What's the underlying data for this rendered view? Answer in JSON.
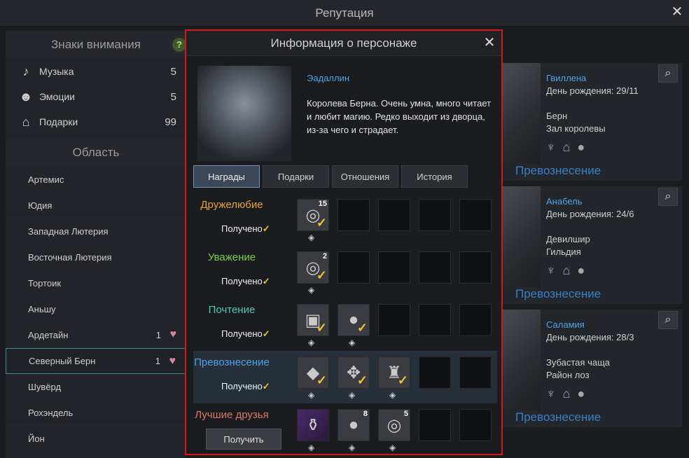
{
  "window": {
    "title": "Репутация"
  },
  "left": {
    "signs_header": "Знаки внимания",
    "help": "?",
    "signs": [
      {
        "label": "Музыка",
        "count": "5",
        "icon": "music-note-icon"
      },
      {
        "label": "Эмоции",
        "count": "5",
        "icon": "emotion-icon"
      },
      {
        "label": "Подарки",
        "count": "99",
        "icon": "gift-icon"
      }
    ],
    "region_header": "Область",
    "regions": [
      {
        "label": "Артемис",
        "count": ""
      },
      {
        "label": "Юдия",
        "count": ""
      },
      {
        "label": "Западная Лютерия",
        "count": ""
      },
      {
        "label": "Восточная Лютерия",
        "count": ""
      },
      {
        "label": "Тортоик",
        "count": ""
      },
      {
        "label": "Аньшу",
        "count": ""
      },
      {
        "label": "Ардетайн",
        "count": "1"
      },
      {
        "label": "Северный Берн",
        "count": "1"
      },
      {
        "label": "Шувёрд",
        "count": ""
      },
      {
        "label": "Рохэндель",
        "count": ""
      },
      {
        "label": "Йон",
        "count": ""
      }
    ]
  },
  "cards": [
    {
      "name": "Гвиллена",
      "bday": "День рождения: 29/11",
      "place1": "Берн",
      "place2": "Зал королевы",
      "rank": "Превознесение"
    },
    {
      "name": "Анабель",
      "bday": "День рождения: 24/6",
      "place1": "Девилшир",
      "place2": "Гильдия",
      "rank": "Превознесение"
    },
    {
      "name": "Саламия",
      "bday": "День рождения: 28/3",
      "place1": "Зубастая чаща",
      "place2": "Район лоз",
      "rank": "Превознесение"
    }
  ],
  "modal": {
    "title": "Информация о персонаже",
    "name": "Эадаллин",
    "desc": "Королева Берна. Очень умна, много читает и любит магию. Редко выходит из дворца, из-за чего и страдает.",
    "tabs": [
      "Награды",
      "Подарки",
      "Отношения",
      "История"
    ],
    "tiers": [
      {
        "name": "Дружелюбие",
        "color": "#e6a23c",
        "status": "Получено",
        "slots": [
          {
            "glyph": "◎",
            "n": "15"
          }
        ]
      },
      {
        "name": "Уважение",
        "color": "#7ccf4a",
        "status": "Получено",
        "slots": [
          {
            "glyph": "◎",
            "n": "2"
          }
        ]
      },
      {
        "name": "Почтение",
        "color": "#4ec9b8",
        "status": "Получено",
        "slots": [
          {
            "glyph": "▣",
            "n": ""
          },
          {
            "glyph": "●",
            "n": ""
          }
        ]
      },
      {
        "name": "Превознесение",
        "color": "#4fa2e8",
        "status": "Получено",
        "slots": [
          {
            "glyph": "◆",
            "n": ""
          },
          {
            "glyph": "✥",
            "n": ""
          },
          {
            "glyph": "♜",
            "n": ""
          }
        ]
      },
      {
        "name": "Лучшие друзья",
        "color": "#e0756a",
        "button": "Получить",
        "slots": [
          {
            "glyph": "⚱",
            "n": ""
          },
          {
            "glyph": "●",
            "n": "8"
          },
          {
            "glyph": "◎",
            "n": "5"
          }
        ]
      }
    ]
  }
}
